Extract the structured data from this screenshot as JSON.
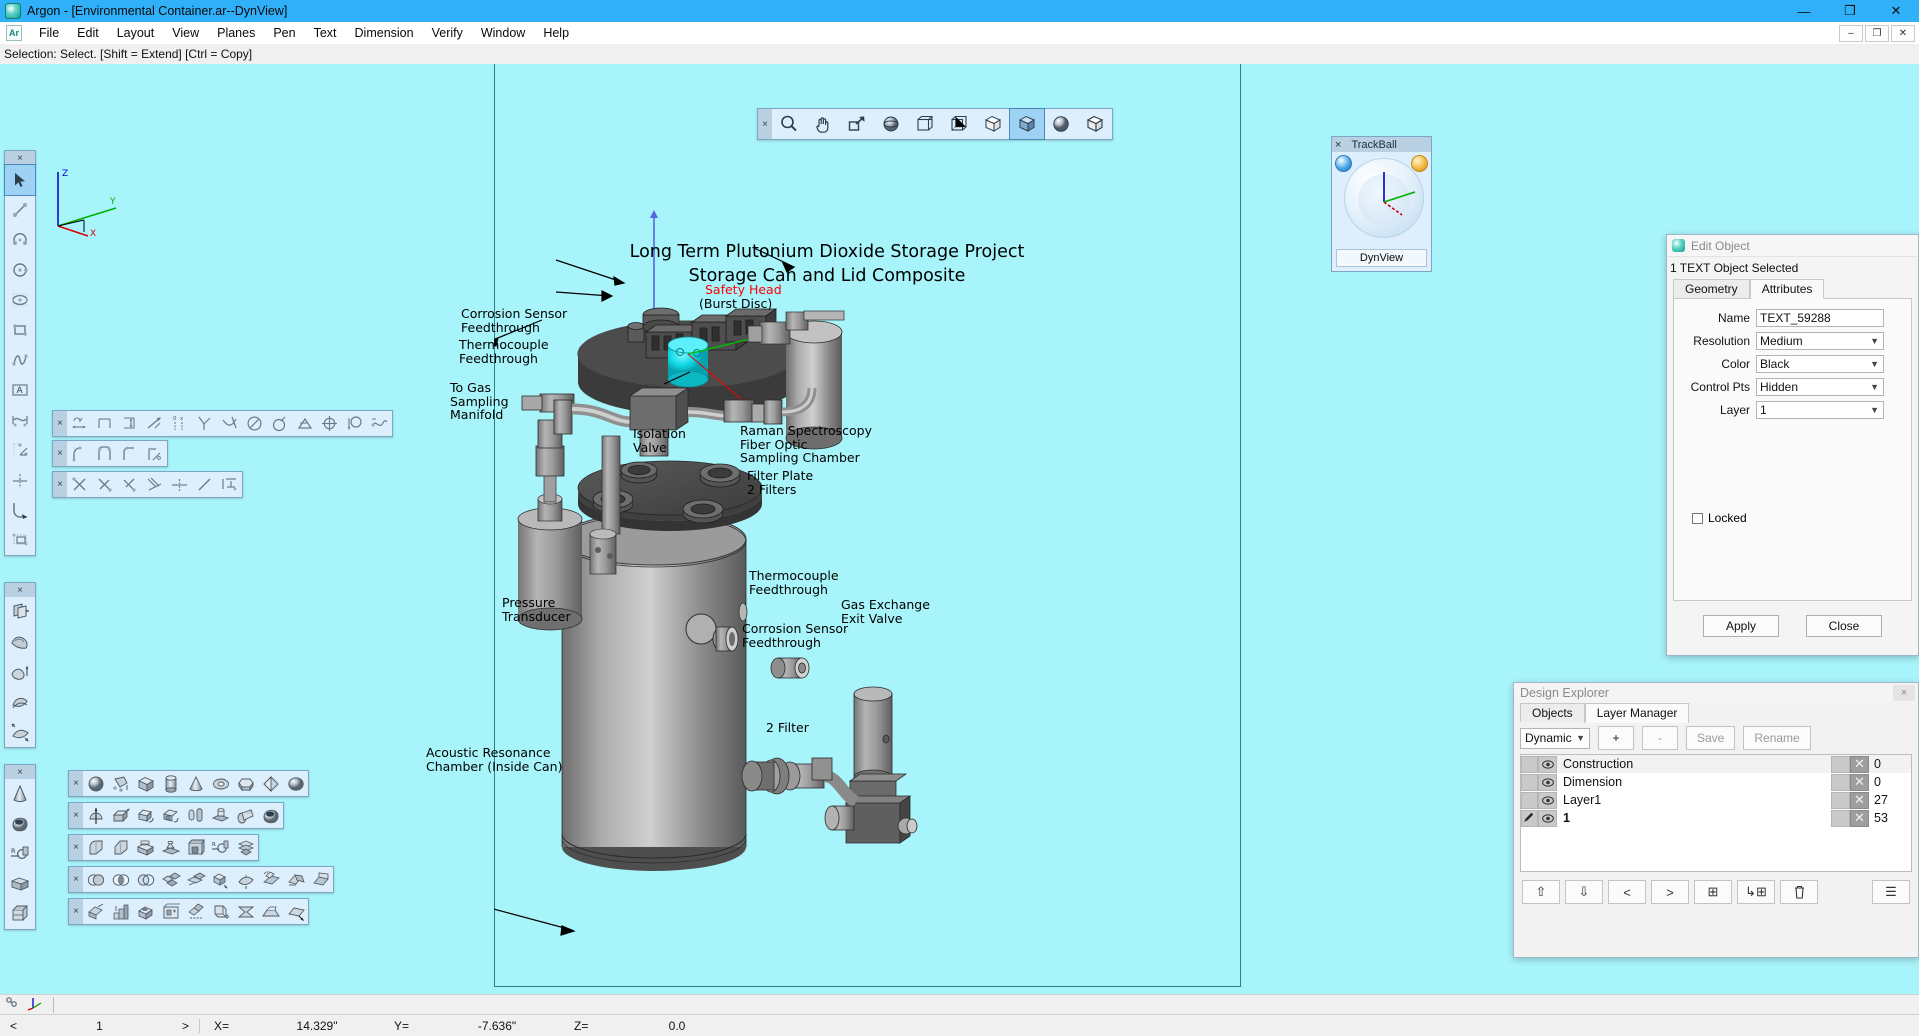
{
  "window": {
    "title": "Argon - [Environmental Container.ar--DynView]",
    "app_icon": "argon-logo-icon",
    "minimize": "—",
    "restore": "❐",
    "close": "✕",
    "mdi_minimize": "–",
    "mdi_restore": "❐",
    "mdi_close": "✕"
  },
  "menu": {
    "items": [
      "File",
      "Edit",
      "Layout",
      "View",
      "Planes",
      "Pen",
      "Text",
      "Dimension",
      "Verify",
      "Window",
      "Help"
    ],
    "icon_label": "Ar"
  },
  "prompt": {
    "text": "Selection: Select. [Shift = Extend] [Ctrl = Copy]"
  },
  "view_toolbar": {
    "close_glyph": "×",
    "items": [
      {
        "name": "zoom-icon",
        "glyph": "zoom"
      },
      {
        "name": "pan-hand-icon",
        "glyph": "hand"
      },
      {
        "name": "zoom-window-icon",
        "glyph": "zoomwin"
      },
      {
        "name": "orbit-sphere-icon",
        "glyph": "orbit"
      },
      {
        "name": "wireframe-cube-icon",
        "glyph": "wire"
      },
      {
        "name": "hidden-line-cube-icon",
        "glyph": "hiddenline"
      },
      {
        "name": "shaded-cube-white-icon",
        "glyph": "shadewhite"
      },
      {
        "name": "shaded-cube-icon",
        "glyph": "shadeblue",
        "selected": true
      },
      {
        "name": "rendered-sphere-icon",
        "glyph": "render"
      },
      {
        "name": "shaded-edges-cube-icon",
        "glyph": "shadeedge"
      }
    ]
  },
  "left_toolbar_draw": {
    "close_glyph": "×",
    "items": [
      {
        "name": "select-arrow-tool",
        "glyph": "arrow",
        "selected": true
      },
      {
        "name": "line-tool",
        "glyph": "line"
      },
      {
        "name": "arc-tool",
        "glyph": "arc"
      },
      {
        "name": "circle-tool",
        "glyph": "circle"
      },
      {
        "name": "ellipse-tool",
        "glyph": "ellipse"
      },
      {
        "name": "rectangle-tool",
        "glyph": "rect"
      },
      {
        "name": "spline-tool",
        "glyph": "spline"
      },
      {
        "name": "text-tool",
        "glyph": "text"
      },
      {
        "name": "dimension-tool",
        "glyph": "dim"
      },
      {
        "name": "construction-line-tool",
        "glyph": "constr"
      },
      {
        "name": "point-tool",
        "glyph": "point"
      },
      {
        "name": "fillet-tool",
        "glyph": "fillet"
      },
      {
        "name": "group-tool",
        "glyph": "group"
      }
    ]
  },
  "left_toolbar_surface": {
    "close_glyph": "×",
    "items": [
      {
        "name": "extrude-surface-tool",
        "glyph": "extrsurf"
      },
      {
        "name": "revolve-surface-tool",
        "glyph": "revsurf"
      },
      {
        "name": "loft-surface-tool",
        "glyph": "loftsurf"
      },
      {
        "name": "sweep-surface-tool",
        "glyph": "sweepsurf"
      },
      {
        "name": "net-surface-tool",
        "glyph": "netsurf"
      }
    ]
  },
  "left_toolbar_solid": {
    "close_glyph": "×",
    "items": [
      {
        "name": "cone-primitive-tool",
        "glyph": "cone"
      },
      {
        "name": "torus-cut-tool",
        "glyph": "toruscut"
      },
      {
        "name": "radius-blend-tool",
        "glyph": "radblend"
      },
      {
        "name": "shell-tool",
        "glyph": "shell"
      },
      {
        "name": "box-section-tool",
        "glyph": "boxsect"
      }
    ]
  },
  "dim_toolbar_1": {
    "close_glyph": "×",
    "items": [
      {
        "name": "linear-dimension-tool",
        "glyph": "dimlin"
      },
      {
        "name": "horizontal-dimension-tool",
        "glyph": "dimhorz"
      },
      {
        "name": "vertical-dimension-tool",
        "glyph": "dimvert"
      },
      {
        "name": "aligned-dimension-tool",
        "glyph": "dimalign"
      },
      {
        "name": "ordinate-dimension-tool",
        "glyph": "dimord"
      },
      {
        "name": "angular-dimension-tool",
        "glyph": "dimang"
      },
      {
        "name": "arc-dimension-tool",
        "glyph": "dimarc"
      },
      {
        "name": "diameter-dimension-tool",
        "glyph": "dimdia"
      },
      {
        "name": "radius-dimension-tool",
        "glyph": "dimrad"
      },
      {
        "name": "chamfer-dimension-tool",
        "glyph": "dimcham"
      },
      {
        "name": "center-mark-tool",
        "glyph": "dimcen"
      },
      {
        "name": "leader-tool",
        "glyph": "dimlead"
      },
      {
        "name": "curve-length-tool",
        "glyph": "dimcurve"
      }
    ]
  },
  "dim_toolbar_2": {
    "close_glyph": "×",
    "items": [
      {
        "name": "fillet-constraint-tool",
        "glyph": "cfillet"
      },
      {
        "name": "corner-constraint-tool",
        "glyph": "ccorner"
      },
      {
        "name": "tangent-constraint-tool",
        "glyph": "ctangent"
      },
      {
        "name": "angle-constraint-tool",
        "glyph": "cangle"
      }
    ]
  },
  "dim_toolbar_3": {
    "close_glyph": "×",
    "items": [
      {
        "name": "trim-tool",
        "glyph": "trim1"
      },
      {
        "name": "trim-two-tool",
        "glyph": "trim2"
      },
      {
        "name": "extend-tool",
        "glyph": "trim3"
      },
      {
        "name": "break-tool",
        "glyph": "trim4"
      },
      {
        "name": "divide-tool",
        "glyph": "divide"
      },
      {
        "name": "offset-line-tool",
        "glyph": "offsetline"
      },
      {
        "name": "align-tool",
        "glyph": "aligntool"
      }
    ]
  },
  "solid_toolbar_1": {
    "close_glyph": "×",
    "items": [
      {
        "name": "sphere-primitive-tool",
        "glyph": "sphere"
      },
      {
        "name": "polygon-primitive-tool",
        "glyph": "polyprim"
      },
      {
        "name": "box-primitive-tool",
        "glyph": "box"
      },
      {
        "name": "cylinder-primitive-tool",
        "glyph": "cyl"
      },
      {
        "name": "cone-primitive-tool",
        "glyph": "cone2"
      },
      {
        "name": "torus-primitive-tool",
        "glyph": "torus"
      },
      {
        "name": "prism-primitive-tool",
        "glyph": "prism"
      },
      {
        "name": "pyramid-primitive-tool",
        "glyph": "pyramid"
      },
      {
        "name": "ellipsoid-primitive-tool",
        "glyph": "ellipsoid"
      }
    ]
  },
  "solid_toolbar_2": {
    "close_glyph": "×",
    "items": [
      {
        "name": "revolve-solid-tool",
        "glyph": "revsolid"
      },
      {
        "name": "extrude-solid-tool",
        "glyph": "extrsolid"
      },
      {
        "name": "sweep-solid-tool",
        "glyph": "sweepsolid"
      },
      {
        "name": "sweep-path-tool",
        "glyph": "sweeppath"
      },
      {
        "name": "loft-solid-tool",
        "glyph": "loftsolid"
      },
      {
        "name": "emboss-tool",
        "glyph": "emboss"
      },
      {
        "name": "thicken-tool",
        "glyph": "thicken"
      },
      {
        "name": "shell-solid-tool",
        "glyph": "shellsolid"
      }
    ]
  },
  "solid_toolbar_3": {
    "close_glyph": "×",
    "items": [
      {
        "name": "fillet-edge-tool",
        "glyph": "filletedge"
      },
      {
        "name": "chamfer-edge-tool",
        "glyph": "chamferedge"
      },
      {
        "name": "boss-tool",
        "glyph": "boss"
      },
      {
        "name": "pad-tool",
        "glyph": "pad"
      },
      {
        "name": "pocket-tool",
        "glyph": "pocket"
      },
      {
        "name": "draft-angle-tool",
        "glyph": "draft"
      },
      {
        "name": "split-tool",
        "glyph": "split"
      }
    ]
  },
  "solid_toolbar_4": {
    "close_glyph": "×",
    "items": [
      {
        "name": "union-boolean-tool",
        "glyph": "bunion"
      },
      {
        "name": "intersect-boolean-tool",
        "glyph": "bintersect"
      },
      {
        "name": "subtract-boolean-tool",
        "glyph": "bsubtract"
      },
      {
        "name": "slice-tool",
        "glyph": "slice"
      },
      {
        "name": "trim-solid-tool",
        "glyph": "trimsolid"
      },
      {
        "name": "move-face-tool",
        "glyph": "moveface"
      },
      {
        "name": "offset-face-tool",
        "glyph": "offsetface"
      },
      {
        "name": "stitch-tool",
        "glyph": "stitch"
      },
      {
        "name": "unfold-tool",
        "glyph": "unfold"
      },
      {
        "name": "bend-tool",
        "glyph": "bend"
      }
    ]
  },
  "solid_toolbar_5": {
    "close_glyph": "×",
    "items": [
      {
        "name": "section-view-tool",
        "glyph": "section"
      },
      {
        "name": "step-tool",
        "glyph": "step"
      },
      {
        "name": "hole-tool",
        "glyph": "hole"
      },
      {
        "name": "pattern-tool",
        "glyph": "pattern"
      },
      {
        "name": "mirror-solid-tool",
        "glyph": "mirrorsolid"
      },
      {
        "name": "wrap-tool",
        "glyph": "wrap"
      },
      {
        "name": "taper-tool",
        "glyph": "taper"
      },
      {
        "name": "rib-tool",
        "glyph": "rib"
      },
      {
        "name": "skew-tool",
        "glyph": "skew"
      }
    ]
  },
  "trackball": {
    "title": "TrackBall",
    "close_glyph": "×",
    "view_name": "DynView",
    "left_badge": "collapse-icon",
    "right_badge": "rotate-icon"
  },
  "drawing": {
    "title": "Long Term Plutonium Dioxide Storage Project\nStorage Can and Lid Composite",
    "axis_labels": {
      "x": "X",
      "y": "Y",
      "z": "Z"
    },
    "callouts": [
      {
        "name": "callout-safety-head",
        "text": "Safety Head",
        "color": "#ff0000"
      },
      {
        "name": "callout-burst-disc",
        "text": "(Burst Disc)",
        "color": "#000000"
      },
      {
        "name": "callout-corrosion-sensor-feedthrough-top",
        "text": "Corrosion Sensor\nFeedthrough"
      },
      {
        "name": "callout-thermocouple-feedthrough-top",
        "text": "Thermocouple\nFeedthrough"
      },
      {
        "name": "callout-gas-sampling-manifold",
        "text": "To Gas\nSampling\nManifold"
      },
      {
        "name": "callout-isolation-valve",
        "text": "Isolation\nValve"
      },
      {
        "name": "callout-raman-chamber",
        "text": "Raman Spectroscopy\nFiber Optic\nSampling Chamber"
      },
      {
        "name": "callout-filter-plate",
        "text": "Filter Plate\n2 Filters"
      },
      {
        "name": "callout-pressure-transducer",
        "text": "Pressure\nTransducer"
      },
      {
        "name": "callout-thermocouple-feedthrough-lower",
        "text": "Thermocouple\nFeedthrough"
      },
      {
        "name": "callout-gas-exchange-exit-valve",
        "text": "Gas Exchange\nExit Valve"
      },
      {
        "name": "callout-corrosion-sensor-feedthrough-lower",
        "text": "Corrosion Sensor\nFeedthrough"
      },
      {
        "name": "callout-two-filter",
        "text": "2 Filter"
      },
      {
        "name": "callout-acoustic-resonance-chamber",
        "text": "Acoustic Resonance\nChamber (Inside Can)"
      }
    ],
    "colors": {
      "background": "#a8f4fb",
      "metal_light": "#b9b9b9",
      "metal_dark": "#4a4a4a",
      "highlight_cyan": "#12e0e8",
      "axis_x": "#ff0000",
      "axis_y": "#00c000",
      "axis_z": "#0000d0",
      "selection_blue": "#5566dd"
    }
  },
  "edit_object": {
    "title": "Edit Object",
    "selection_text": "1 TEXT Object Selected",
    "tabs": [
      {
        "label": "Geometry",
        "active": false
      },
      {
        "label": "Attributes",
        "active": true
      }
    ],
    "fields": [
      {
        "label": "Name",
        "value": "TEXT_59288",
        "type": "text"
      },
      {
        "label": "Resolution",
        "value": "Medium",
        "type": "select"
      },
      {
        "label": "Color",
        "value": "Black",
        "type": "select"
      },
      {
        "label": "Control Pts",
        "value": "Hidden",
        "type": "select"
      },
      {
        "label": "Layer",
        "value": "1",
        "type": "select"
      }
    ],
    "locked_label": "Locked",
    "locked_checked": false,
    "apply_label": "Apply",
    "close_label": "Close"
  },
  "design_explorer": {
    "title": "Design Explorer",
    "close_glyph": "×",
    "tabs": [
      {
        "label": "Objects",
        "active": false
      },
      {
        "label": "Layer Manager",
        "active": true
      }
    ],
    "mode_select": "Dynamic",
    "buttons": [
      {
        "name": "add-layer-button",
        "label": "+",
        "disabled": false
      },
      {
        "name": "remove-layer-button",
        "label": "-",
        "disabled": true
      },
      {
        "name": "save-layer-button",
        "label": "Save",
        "disabled": true
      },
      {
        "name": "rename-layer-button",
        "label": "Rename",
        "disabled": true
      }
    ],
    "layers": [
      {
        "name": "Construction",
        "count": "0",
        "visible": true,
        "active": false,
        "bold": false
      },
      {
        "name": "Dimension",
        "count": "0",
        "visible": true,
        "active": false,
        "bold": false
      },
      {
        "name": "Layer1",
        "count": "27",
        "visible": true,
        "active": false,
        "bold": false
      },
      {
        "name": "1",
        "count": "53",
        "visible": true,
        "active": true,
        "bold": true
      }
    ],
    "bottom_buttons": [
      {
        "name": "move-up-button",
        "glyph": "⇧"
      },
      {
        "name": "move-down-button",
        "glyph": "⇩"
      },
      {
        "name": "move-left-button",
        "glyph": "<"
      },
      {
        "name": "move-right-button",
        "glyph": ">"
      },
      {
        "name": "new-layer-button",
        "glyph": "⊞"
      },
      {
        "name": "insert-layer-button",
        "glyph": "↳⊞"
      },
      {
        "name": "delete-layer-button",
        "glyph": "Ὕ1"
      },
      {
        "name": "layer-menu-button",
        "glyph": "☰"
      }
    ]
  },
  "command_bar": {
    "snap_icon": "snap-icon",
    "axis_icon": "axis-triad-icon",
    "input_value": ""
  },
  "status_bar": {
    "prev_glyph": "<",
    "page": "1",
    "next_glyph": ">",
    "coords": [
      {
        "key": "X=",
        "value": "14.329\""
      },
      {
        "key": "Y=",
        "value": "-7.636\""
      },
      {
        "key": "Z=",
        "value": "0.0"
      }
    ]
  }
}
